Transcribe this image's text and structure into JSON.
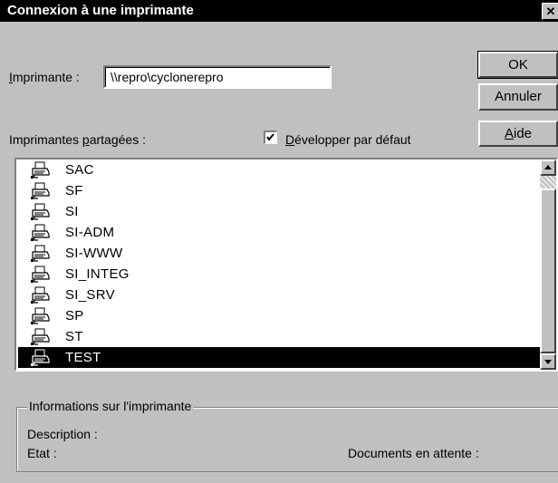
{
  "window": {
    "title": "Connexion à une imprimante",
    "close_glyph": "✕"
  },
  "printer": {
    "label_prefix": "",
    "label_access": "I",
    "label_rest": "mprimante :",
    "value": "\\\\repro\\cyclonerepro"
  },
  "buttons": {
    "ok": "OK",
    "cancel": "Annuler",
    "help_access": "A",
    "help_rest": "ide"
  },
  "shared": {
    "label_prefix": "Imprimantes ",
    "label_access": "p",
    "label_rest": "artagées :"
  },
  "expand": {
    "checked": true,
    "label_access": "D",
    "label_rest": "évelopper par défaut"
  },
  "list": {
    "items": [
      "SAC",
      "SF",
      "SI",
      "SI-ADM",
      "SI-WWW",
      "SI_INTEG",
      "SI_SRV",
      "SP",
      "ST",
      "TEST"
    ],
    "selected_index": 9,
    "item_icon": "printer-icon"
  },
  "info": {
    "group_title": "Informations sur l'imprimante",
    "description_label": "Description :",
    "state_label": "Etat :",
    "queue_label": "Documents en attente :"
  },
  "colors": {
    "title_bg": "#000000",
    "face": "#c0c0c0",
    "selection_bg": "#000000"
  }
}
